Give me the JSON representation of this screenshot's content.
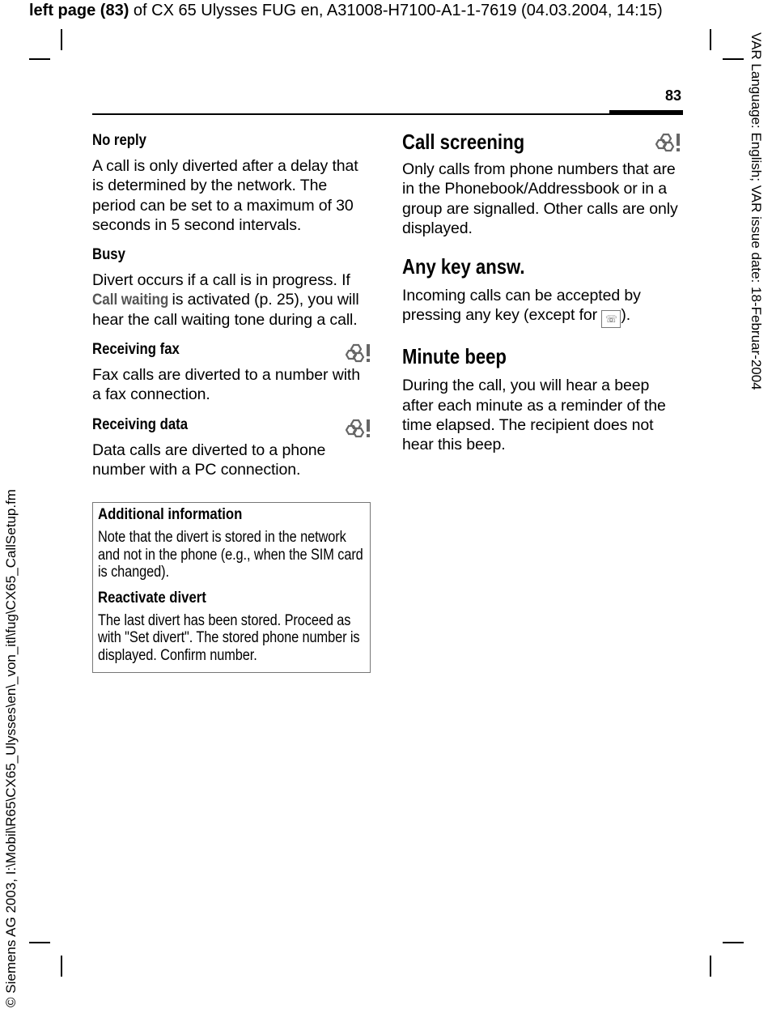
{
  "header": {
    "bold": "left page (83)",
    "rest": " of CX 65 Ulysses FUG en, A31008-H7100-A1-1-7619 (04.03.2004, 14:15)"
  },
  "page_number": "83",
  "side_right": "VAR Language: English; VAR issue date: 18-Februar-2004",
  "side_left": "© Siemens AG 2003, I:\\Mobil\\R65\\CX65_Ulysses\\en\\_von_itl\\fug\\CX65_CallSetup.fm",
  "left": {
    "no_reply": {
      "title": "No reply",
      "text": "A call is only diverted after a delay that is determined by the network. The period can be set to a maximum of 30 seconds in 5 second intervals."
    },
    "busy": {
      "title": "Busy",
      "text1": "Divert occurs if a call is in progress. If ",
      "menu": "Call waiting",
      "text2": " is activated (p. 25), you will hear the call waiting tone during a call."
    },
    "fax": {
      "title": "Receiving fax",
      "text": "Fax calls are diverted to a number with a fax connection.",
      "icon": "network-service-icon"
    },
    "data": {
      "title": "Receiving data",
      "text": "Data calls are diverted to a phone number with a PC connection.",
      "icon": "network-service-icon"
    },
    "info": {
      "title": "Additional information",
      "text": "Note that the divert is stored in the network and not in the phone (e.g., when the SIM card is changed).",
      "title2": "Reactivate divert",
      "text2": "The last divert has been stored. Proceed as with \"Set divert\". The stored phone number is displayed. Confirm number."
    }
  },
  "right": {
    "screening": {
      "title": "Call screening",
      "text": "Only calls from phone numbers that are in the Phonebook/Addressbook or in a group are signalled. Other calls are only displayed.",
      "icon": "network-service-icon"
    },
    "anykey": {
      "title": "Any key answ.",
      "text1": "Incoming calls can be accepted by pressing any key (except for ",
      "key": "end-key-icon",
      "text2": ")."
    },
    "beep": {
      "title": "Minute beep",
      "text": "During the call, you will hear a beep after each minute as a reminder of the time elapsed. The recipient does not hear this beep."
    }
  }
}
